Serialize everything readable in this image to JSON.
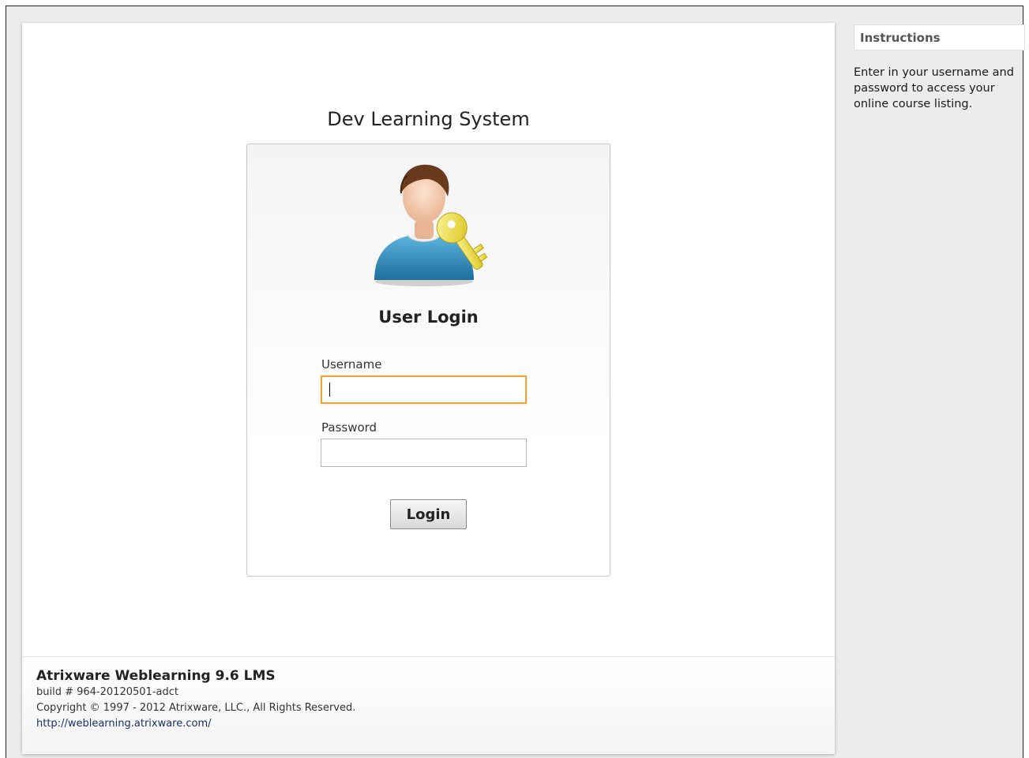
{
  "site": {
    "title": "Dev Learning System"
  },
  "login": {
    "heading": "User Login",
    "username_label": "Username",
    "username_value": "",
    "password_label": "Password",
    "password_value": "",
    "button_label": "Login",
    "avatar_icon": "user-key-icon"
  },
  "footer": {
    "product": "Atrixware Weblearning 9.6 LMS",
    "build": "build # 964-20120501-adct",
    "copyright": "Copyright © 1997 - 2012 Atrixware, LLC., All Rights Reserved.",
    "link": "http://weblearning.atrixware.com/"
  },
  "sidebar": {
    "header": "Instructions",
    "text": "Enter in your username and password to access your online course listing."
  },
  "colors": {
    "focus_border": "#e9a63c",
    "link": "#1a2f6b",
    "sidebar_bg": "#ececec"
  }
}
